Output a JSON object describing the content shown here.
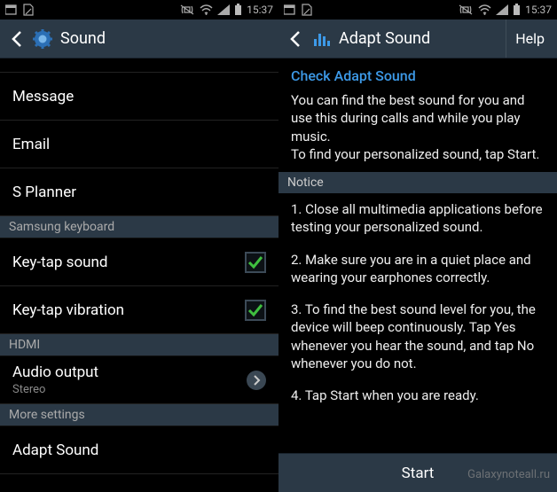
{
  "status": {
    "time": "15:37"
  },
  "left": {
    "header": {
      "title": "Sound"
    },
    "rows": [
      {
        "label": "Message"
      },
      {
        "label": "Email"
      },
      {
        "label": "S Planner"
      }
    ],
    "section1": "Samsung keyboard",
    "kb_rows": [
      {
        "label": "Key-tap sound",
        "checked": true
      },
      {
        "label": "Key-tap vibration",
        "checked": true
      }
    ],
    "section2": "HDMI",
    "audio": {
      "label": "Audio output",
      "sub": "Stereo"
    },
    "section3": "More settings",
    "more_row": "Adapt Sound"
  },
  "right": {
    "header": {
      "title": "Adapt Sound",
      "help": "Help"
    },
    "check_title": "Check Adapt Sound",
    "body1": "You can find the best sound for you and use this during calls and while you play music.",
    "body2": "To find your personalized sound, tap Start.",
    "notice_label": "Notice",
    "n1": "1. Close all multimedia applications before testing your personalized sound.",
    "n2": "2. Make sure you are in a quiet place and wearing your earphones correctly.",
    "n3": "3. To find the best sound level for you, the device will beep continuously. Tap Yes whenever you hear the sound, and tap No whenever you do not.",
    "n4": "4. Tap Start when you are ready.",
    "start": "Start"
  },
  "watermark": "Galaxynoteall.ru"
}
